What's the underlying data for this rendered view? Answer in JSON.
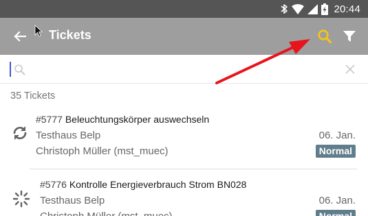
{
  "status_bar": {
    "time": "20:44",
    "icons": [
      "bluetooth-icon",
      "wifi-icon",
      "signal-icon",
      "battery-icon"
    ]
  },
  "app_bar": {
    "title": "Tickets",
    "background": "#9e9e9e",
    "search_icon_color": "#f5c518"
  },
  "search": {
    "placeholder": "",
    "value": ""
  },
  "ticket_count": "35 Tickets",
  "tickets": [
    {
      "number": "#5777",
      "title": "Beleuchtungskörper auswechseln",
      "location": "Testhaus Belp",
      "date": "06. Jan.",
      "person": "Christoph Müller (mst_muec)",
      "priority": "Normal",
      "status_icon": "sync-icon"
    },
    {
      "number": "#5776",
      "title": "Kontrolle Energieverbrauch Strom BN028",
      "location": "Testhaus Belp",
      "date": "06. Jan.",
      "person": "Christoph Müller (mst_muec)",
      "priority": "Normal",
      "status_icon": "spinner-icon"
    }
  ],
  "colors": {
    "badge": "#607d8b",
    "annotation_arrow": "#e8141c",
    "status_bar": "#555555"
  }
}
